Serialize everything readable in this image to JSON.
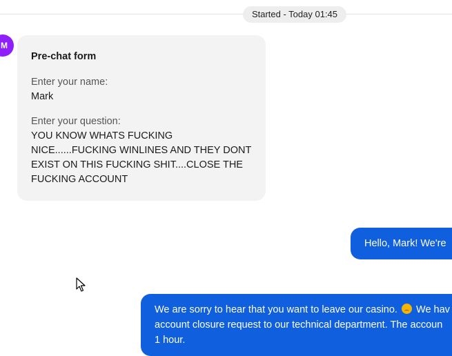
{
  "conversation": {
    "started_label": "Started - Today 01:45"
  },
  "avatar": {
    "initial": "M",
    "color": "#8f1ffb"
  },
  "prechat": {
    "title": "Pre-chat form",
    "fields": [
      {
        "label": "Enter your name:",
        "value": "Mark"
      },
      {
        "label": "Enter your question:",
        "value": "YOU KNOW WHATS FUCKING NICE......FUCKING WINLINES AND THEY DONT EXIST ON THIS FUCKING SHIT....CLOSE THE FUCKING ACCOUNT"
      }
    ]
  },
  "messages": [
    {
      "id": "hello",
      "text": "Hello, Mark! We're"
    },
    {
      "id": "sorry",
      "line1_before_emoji": "We are sorry to hear that you want to leave our casino.",
      "emoji": "sad-face-emoji",
      "line1_after_emoji": "We hav",
      "line2": "account closure request to our technical department. The accoun",
      "line3": "1 hour."
    }
  ],
  "colors": {
    "agent_bubble": "#0f5fdf",
    "card_bg": "#f3f3f3"
  }
}
